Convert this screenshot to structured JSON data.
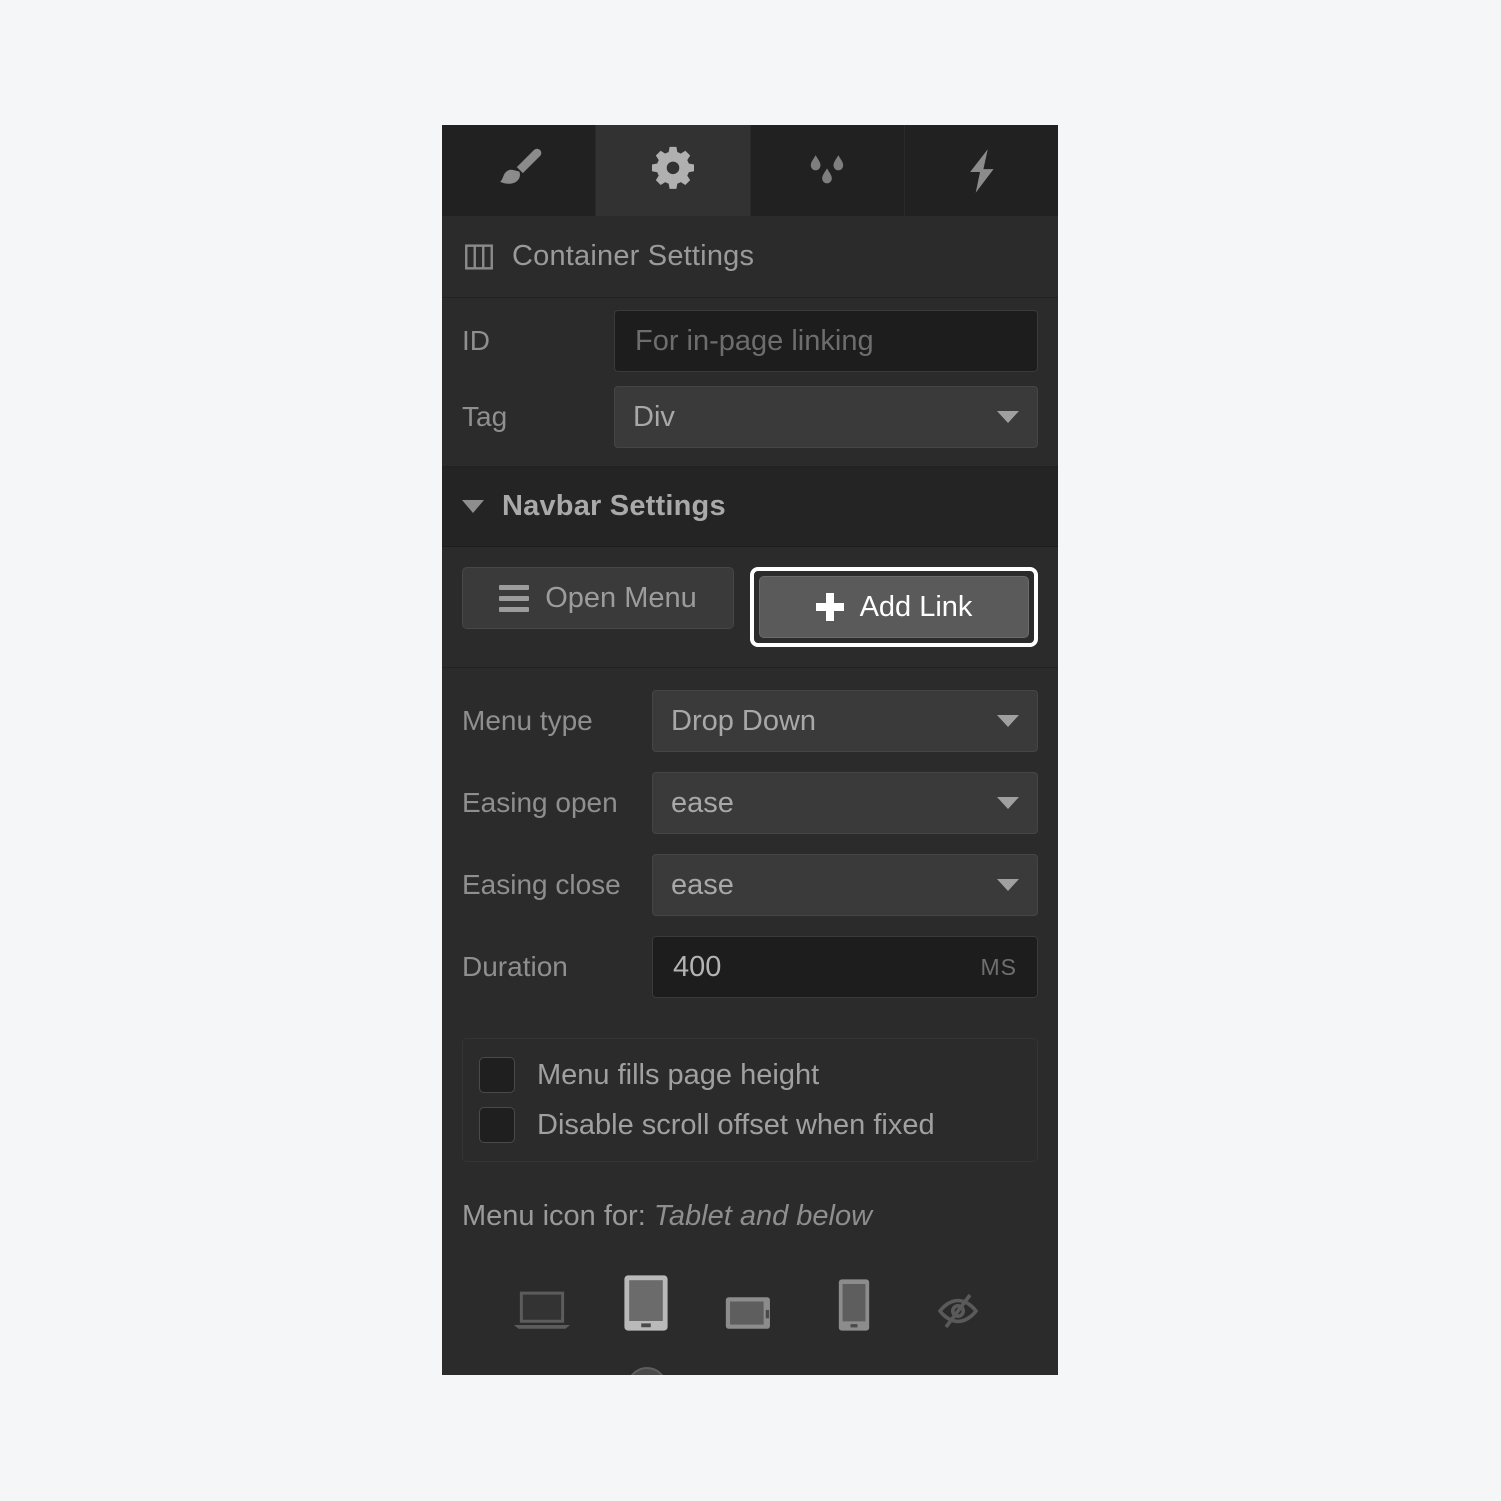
{
  "panel": {
    "tabs": [
      {
        "name": "style-tab",
        "icon": "paintbrush-icon",
        "active": false
      },
      {
        "name": "settings-tab",
        "icon": "gear-icon",
        "active": true
      },
      {
        "name": "style-manager-tab",
        "icon": "droplets-icon",
        "active": false
      },
      {
        "name": "interactions-tab",
        "icon": "lightning-icon",
        "active": false
      }
    ],
    "header": {
      "icon": "container-columns-icon",
      "title": "Container Settings"
    },
    "container_fields": {
      "id_label": "ID",
      "id_placeholder": "For in-page linking",
      "id_value": "",
      "tag_label": "Tag",
      "tag_value": "Div"
    },
    "navbar_section": {
      "title": "Navbar Settings",
      "expanded": true,
      "open_menu_label": "Open Menu",
      "add_link_label": "Add Link",
      "add_link_focused": true,
      "menu_type_label": "Menu type",
      "menu_type_value": "Drop Down",
      "easing_open_label": "Easing open",
      "easing_open_value": "ease",
      "easing_close_label": "Easing close",
      "easing_close_value": "ease",
      "duration_label": "Duration",
      "duration_value": "400",
      "duration_unit": "MS",
      "checkboxes": [
        {
          "label": "Menu fills page height",
          "checked": false
        },
        {
          "label": "Disable scroll offset when fixed",
          "checked": false
        }
      ],
      "menu_icon_caption_prefix": "Menu icon for:",
      "menu_icon_caption_value": "Tablet and below",
      "devices": [
        {
          "name": "desktop-laptop-icon",
          "active": false
        },
        {
          "name": "tablet-portrait-icon",
          "active": true
        },
        {
          "name": "tablet-landscape-icon",
          "active": false
        },
        {
          "name": "phone-portrait-icon",
          "active": false
        },
        {
          "name": "hidden-eye-slash-icon",
          "active": false
        }
      ],
      "slider_position_percent": 23
    }
  },
  "colors": {
    "page_background": "#f4f6f8",
    "panel_background": "#2b2b2b",
    "tab_active_background": "#323232",
    "focus_ring": "#ffffff",
    "primary_button": "#5a5a5a"
  }
}
